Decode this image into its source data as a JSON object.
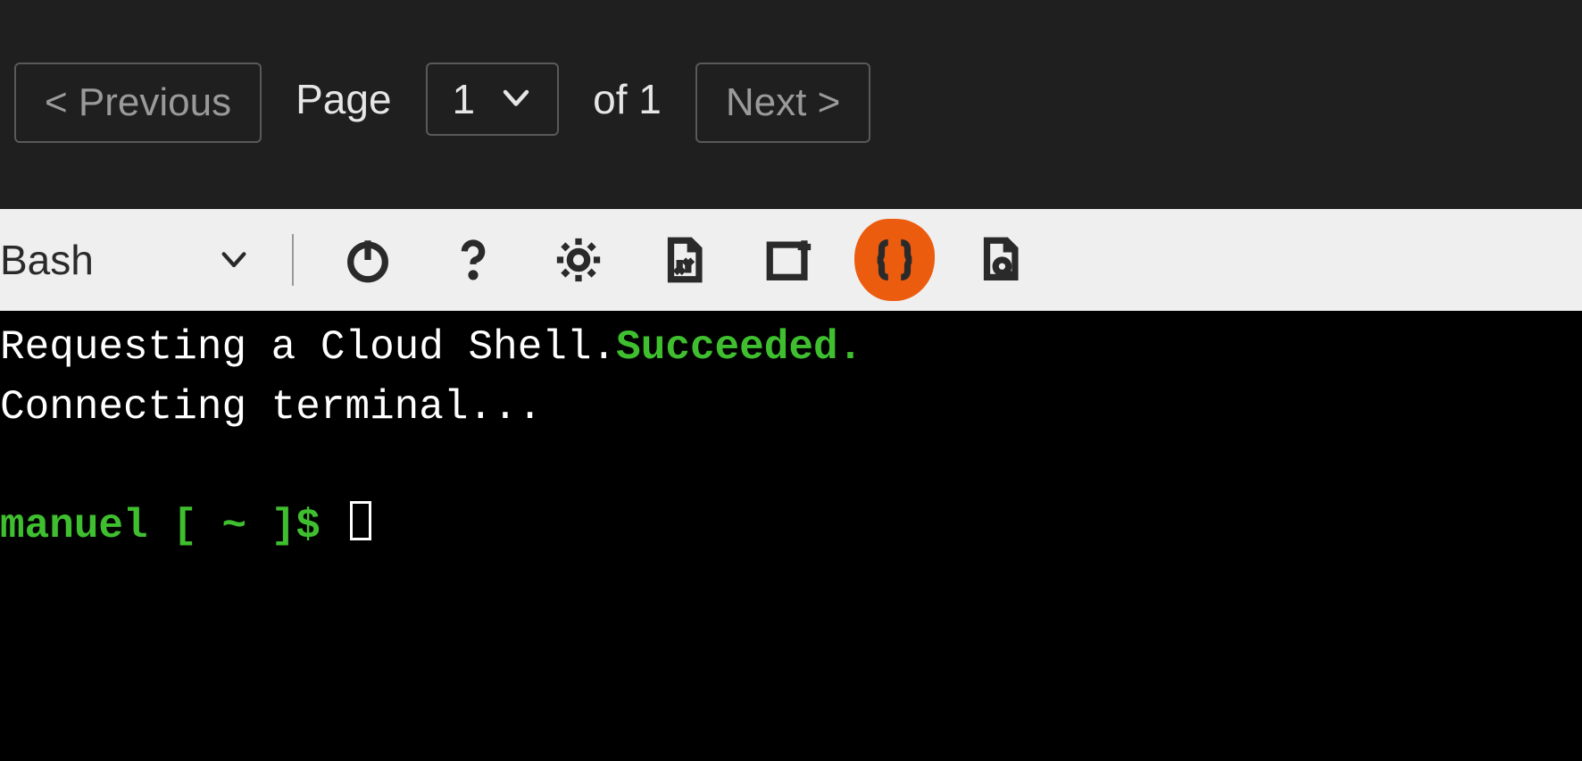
{
  "pagination": {
    "previous_label": "< Previous",
    "page_label": "Page",
    "current_page": "1",
    "of_label": "of",
    "total_pages": "1",
    "next_label": "Next >"
  },
  "shell_toolbar": {
    "shell_name": "Bash"
  },
  "terminal": {
    "line1_prefix": "Requesting a Cloud Shell.",
    "line1_status": "Succeeded.",
    "line2": "Connecting terminal...",
    "prompt_user": "manuel",
    "prompt_path": " [ ~ ]$ "
  },
  "colors": {
    "highlight": "#eb5c0f",
    "terminal_green": "#3fbf2f"
  }
}
